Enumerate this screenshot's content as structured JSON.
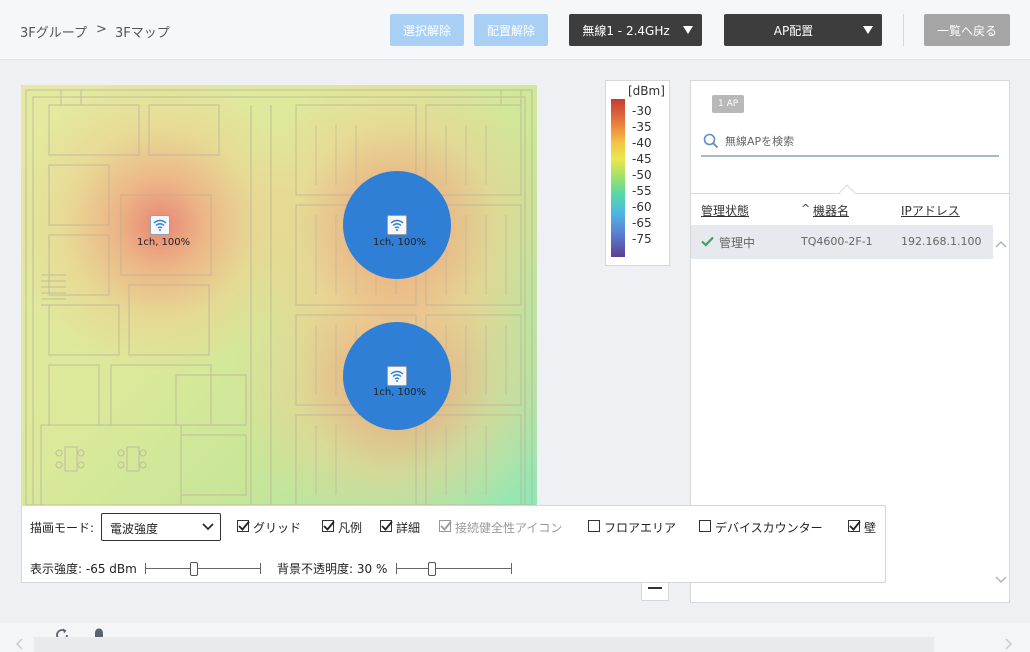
{
  "breadcrumb": {
    "parent": "3Fグループ",
    "separator": ">",
    "current": "3Fマップ"
  },
  "toolbar": {
    "deselect_label": "選択解除",
    "unplace_label": "配置解除",
    "band_select": "無線1 - 2.4GHz",
    "mode_select": "AP配置",
    "back_label": "一覧へ戻る"
  },
  "map": {
    "access_points": [
      {
        "label": "1ch, 100%",
        "selected": false
      },
      {
        "label": "1ch, 100%",
        "selected": true
      },
      {
        "label": "1ch, 100%",
        "selected": true
      }
    ]
  },
  "legend": {
    "unit": "[dBm]",
    "ticks": [
      "-30",
      "-35",
      "-40",
      "-45",
      "-50",
      "-55",
      "-60",
      "-65",
      "-75"
    ],
    "colors": {
      "high": "#c43c35",
      "mid": "#9ee06a",
      "low": "#5c3f8c"
    }
  },
  "panel": {
    "badge": "1 AP",
    "search_placeholder": "無線APを検索",
    "columns": {
      "status": "管理状態",
      "sort_indicator": "^",
      "device": "機器名",
      "ip": "IPアドレス"
    },
    "rows": [
      {
        "status": "管理中",
        "device": "TQ4600-2F-1",
        "ip": "192.168.1.100",
        "status_color": "#3aa55c"
      }
    ]
  },
  "controls": {
    "draw_mode_label": "描画モード:",
    "draw_mode_value": "電波強度",
    "checkboxes": {
      "grid": {
        "label": "グリッド",
        "checked": true
      },
      "legend": {
        "label": "凡例",
        "checked": true
      },
      "detail": {
        "label": "詳細",
        "checked": true
      },
      "health_icon": {
        "label": "接続健全性アイコン",
        "checked": true,
        "disabled": true
      },
      "floor_area": {
        "label": "フロアエリア",
        "checked": false
      },
      "device_counter": {
        "label": "デバイスカウンター",
        "checked": false
      },
      "wall": {
        "label": "壁",
        "checked": true
      }
    },
    "strength_label": "表示強度: -65 dBm",
    "strength_level": 0.42,
    "opacity_label": "背景不透明度: 30 %",
    "opacity_level": 0.3
  },
  "bottombar": {
    "icons": [
      "refresh-icon",
      "bell-icon"
    ]
  },
  "accent": "#2f7fd6"
}
